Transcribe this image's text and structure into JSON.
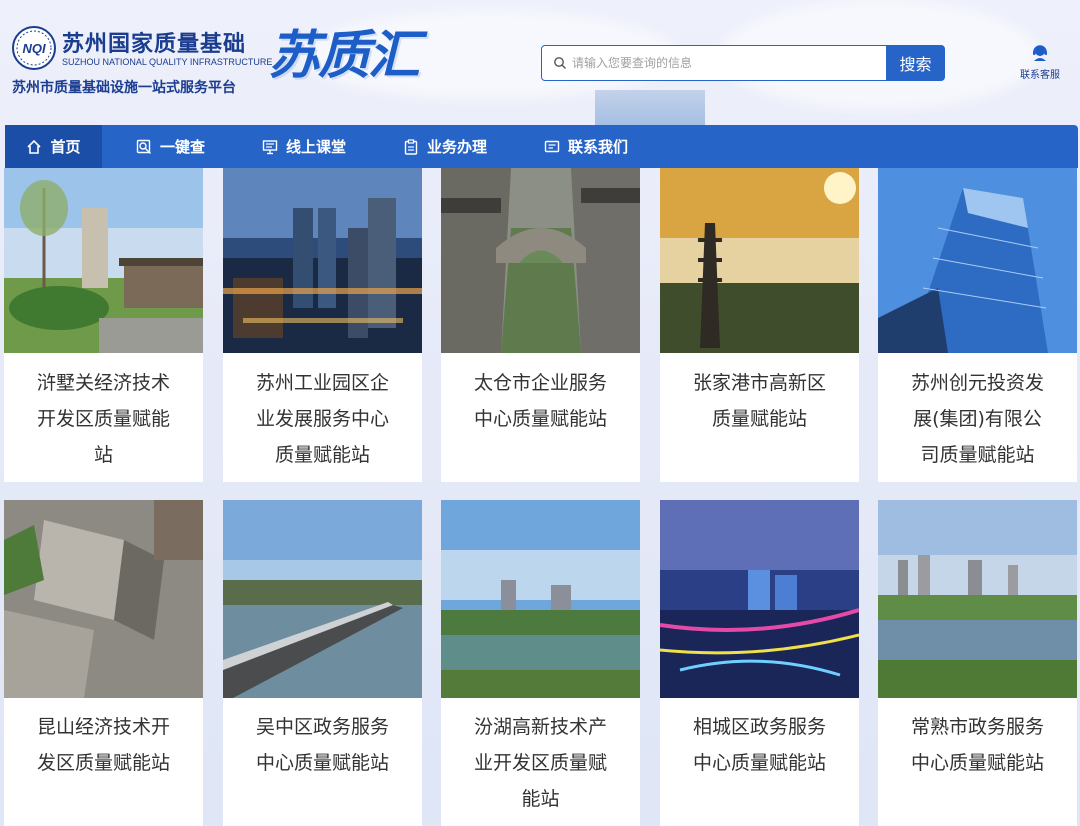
{
  "header": {
    "logo_badge_text": "NQI",
    "org_title": "苏州国家质量基础",
    "org_title_en": "SUZHOU NATIONAL QUALITY INFRASTRUCTURE",
    "platform_subtitle": "苏州市质量基础设施一站式服务平台",
    "brand": "苏质汇"
  },
  "search": {
    "placeholder": "请输入您要查询的信息",
    "button_label": "搜索"
  },
  "service": {
    "label": "联系客服",
    "icon": "customer-service-icon"
  },
  "nav": {
    "items": [
      {
        "label": "首页",
        "icon": "home-icon",
        "active": true
      },
      {
        "label": "一键查",
        "icon": "search-doc-icon"
      },
      {
        "label": "线上课堂",
        "icon": "classroom-icon"
      },
      {
        "label": "业务办理",
        "icon": "clipboard-icon"
      },
      {
        "label": "联系我们",
        "icon": "message-icon"
      }
    ]
  },
  "stations": [
    {
      "lines": [
        "浒墅关经济技术",
        "开发区质量赋能",
        "站"
      ]
    },
    {
      "lines": [
        "苏州工业园区企",
        "业发展服务中心",
        "质量赋能站"
      ]
    },
    {
      "lines": [
        "太仓市企业服务",
        "中心质量赋能站"
      ]
    },
    {
      "lines": [
        "张家港市高新区",
        "质量赋能站"
      ]
    },
    {
      "lines": [
        "苏州创元投资发",
        "展(集团)有限公",
        "司质量赋能站"
      ]
    },
    {
      "lines": [
        "昆山经济技术开",
        "发区质量赋能站"
      ]
    },
    {
      "lines": [
        "吴中区政务服务",
        "中心质量赋能站"
      ]
    },
    {
      "lines": [
        "汾湖高新技术产",
        "业开发区质量赋",
        "能站"
      ]
    },
    {
      "lines": [
        "相城区政务服务",
        "中心质量赋能站"
      ]
    },
    {
      "lines": [
        "常熟市政务服务",
        "中心质量赋能站"
      ]
    }
  ],
  "colors": {
    "primary": "#2764c8",
    "nav_active": "#1b4ea6",
    "brand": "#1d5dc7"
  }
}
